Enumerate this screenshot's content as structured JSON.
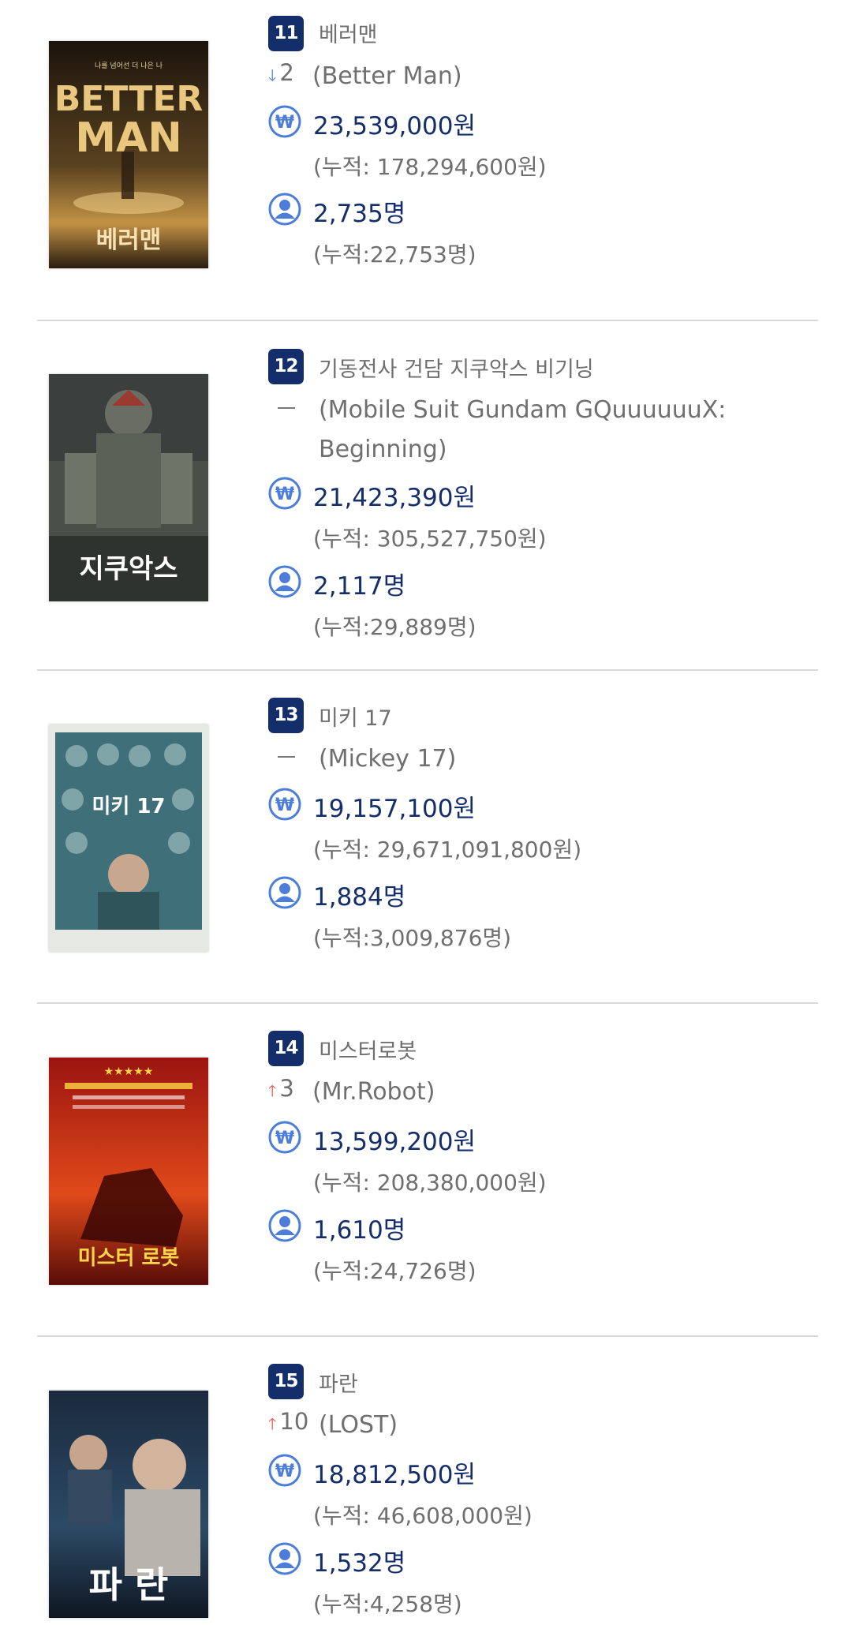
{
  "colors": {
    "badge": "#142d6b",
    "accent": "#4c7ed9",
    "up": "#e8504b",
    "text_muted": "#6f6f6f",
    "divider": "#d9d9d9"
  },
  "movies": [
    {
      "rank": "11",
      "title_ko": "베러맨",
      "change": {
        "direction": "down",
        "value": "2"
      },
      "title_en": "(Better Man)",
      "sales": "23,539,000원",
      "sales_cum": "(누적: 178,294,600원)",
      "audience": "2,735명",
      "audience_cum": "(누적:22,753명)",
      "poster": {
        "text_top": "BETTER",
        "text_mid": "MAN",
        "text_bottom": "베러맨",
        "tagline": "나를 넘어선 더 나은 나"
      }
    },
    {
      "rank": "12",
      "title_ko": "기동전사 건담 지쿠악스 비기닝",
      "change": {
        "direction": "none",
        "value": ""
      },
      "title_en": "(Mobile Suit Gundam GQuuuuuuX: Beginning)",
      "sales": "21,423,390원",
      "sales_cum": "(누적: 305,527,750원)",
      "audience": "2,117명",
      "audience_cum": "(누적:29,889명)",
      "poster": {
        "text_bottom": "지쿠악스"
      }
    },
    {
      "rank": "13",
      "title_ko": "미키 17",
      "change": {
        "direction": "none",
        "value": ""
      },
      "title_en": "(Mickey 17)",
      "sales": "19,157,100원",
      "sales_cum": "(누적: 29,671,091,800원)",
      "audience": "1,884명",
      "audience_cum": "(누적:3,009,876명)",
      "poster": {
        "text_mid": "미키 17"
      }
    },
    {
      "rank": "14",
      "title_ko": "미스터로봇",
      "change": {
        "direction": "up",
        "value": "3"
      },
      "title_en": "(Mr.Robot)",
      "sales": "13,599,200원",
      "sales_cum": "(누적: 208,380,000원)",
      "audience": "1,610명",
      "audience_cum": "(누적:24,726명)",
      "poster": {
        "text_bottom": "미스터 로봇",
        "stars": "★★★★★"
      }
    },
    {
      "rank": "15",
      "title_ko": "파란",
      "change": {
        "direction": "up",
        "value": "10"
      },
      "title_en": "(LOST)",
      "sales": "18,812,500원",
      "sales_cum": "(누적: 46,608,000원)",
      "audience": "1,532명",
      "audience_cum": "(누적:4,258명)",
      "poster": {
        "text_bottom": "파 란"
      }
    }
  ]
}
